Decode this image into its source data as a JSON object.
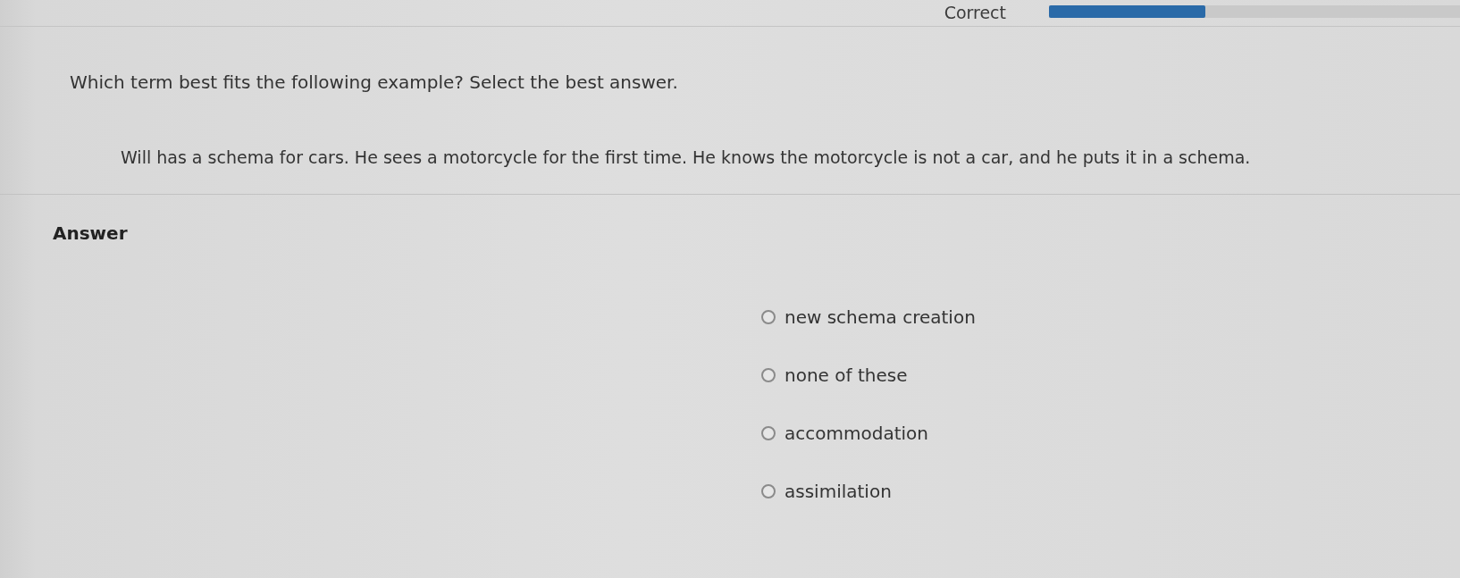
{
  "header": {
    "status": "Correct",
    "progress": {
      "level": 0.38
    }
  },
  "question": {
    "prompt": "Which term best fits the following example? Select the best answer.",
    "example": "Will has a schema for cars. He sees a motorcycle for the first time. He knows the motorcycle is not a car, and he puts it in a schema."
  },
  "answer": {
    "heading": "Answer",
    "options": [
      {
        "label": "new schema creation",
        "selected": false
      },
      {
        "label": "none of these",
        "selected": false
      },
      {
        "label": "accommodation",
        "selected": false
      },
      {
        "label": "assimilation",
        "selected": false
      }
    ]
  }
}
